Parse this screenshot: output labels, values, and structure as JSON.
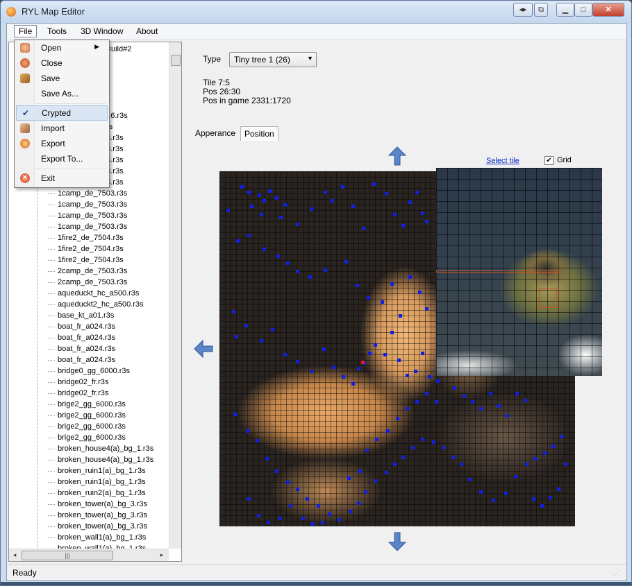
{
  "window": {
    "title": "RYL Map Editor",
    "controls": [
      "minimize",
      "maximize",
      "close"
    ]
  },
  "menubar": [
    "File",
    "Tools",
    "3D Window",
    "About"
  ],
  "file_menu": [
    {
      "label": "Open",
      "icon": "open-icon",
      "submenu": true
    },
    {
      "label": "Close",
      "icon": "close-doc-icon"
    },
    {
      "label": "Save",
      "icon": "save-icon"
    },
    {
      "label": "Save As...",
      "icon": ""
    },
    {
      "label": "Crypted",
      "icon": "check-icon",
      "checked": true
    },
    {
      "label": "Import",
      "icon": "import-icon"
    },
    {
      "label": "Export",
      "icon": "export-icon"
    },
    {
      "label": "Export To...",
      "icon": ""
    },
    {
      "label": "Exit",
      "icon": "exit-icon"
    }
  ],
  "tree": {
    "root_partial": "le Build#2",
    "partial_items": [
      "216.r3s",
      "r3s",
      "03.r3s",
      "03.r3s",
      "03.r3s",
      "03.r3s",
      "03.r3s"
    ],
    "items": [
      "1camp_de_7503.r3s",
      "1camp_de_7503.r3s",
      "1camp_de_7503.r3s",
      "1camp_de_7503.r3s",
      "1fire2_de_7504.r3s",
      "1fire2_de_7504.r3s",
      "1fire2_de_7504.r3s",
      "2camp_de_7503.r3s",
      "2camp_de_7503.r3s",
      "aqueduckt_hc_a500.r3s",
      "aqueduckt2_hc_a500.r3s",
      "base_kt_a01.r3s",
      "boat_fr_a024.r3s",
      "boat_fr_a024.r3s",
      "boat_fr_a024.r3s",
      "boat_fr_a024.r3s",
      "bridge0_gg_6000.r3s",
      "bridge02_fr.r3s",
      "bridge02_fr.r3s",
      "brige2_gg_6000.r3s",
      "brige2_gg_6000.r3s",
      "brige2_gg_6000.r3s",
      "brige2_gg_6000.r3s",
      "broken_house4(a)_bg_1.r3s",
      "broken_house4(a)_bg_1.r3s",
      "broken_ruin1(a)_bg_1.r3s",
      "broken_ruin1(a)_bg_1.r3s",
      "broken_ruin2(a)_bg_1.r3s",
      "broken_tower(a)_bg_3.r3s",
      "broken_tower(a)_bg_3.r3s",
      "broken_tower(a)_bg_3.r3s",
      "broken_wall1(a)_bg_1.r3s",
      "broken_wall1(a)_bg_1.r3s"
    ]
  },
  "properties": {
    "type_label": "Type",
    "type_value": "Tiny tree 1 (26)",
    "tile": "Tile 7:5",
    "pos": "Pos 26:30",
    "pos_in_game": "Pos in game 2331:1720"
  },
  "tabs": [
    "Apperance",
    "Position"
  ],
  "map_panel": {
    "select_tile_link": "Select tile",
    "grid_label": "Grid",
    "grid_checked": true
  },
  "status": {
    "text": "Ready"
  },
  "colors": {
    "marker": "#1020e0",
    "selected_marker": "#e02020",
    "accent": "#3a6ec8"
  }
}
